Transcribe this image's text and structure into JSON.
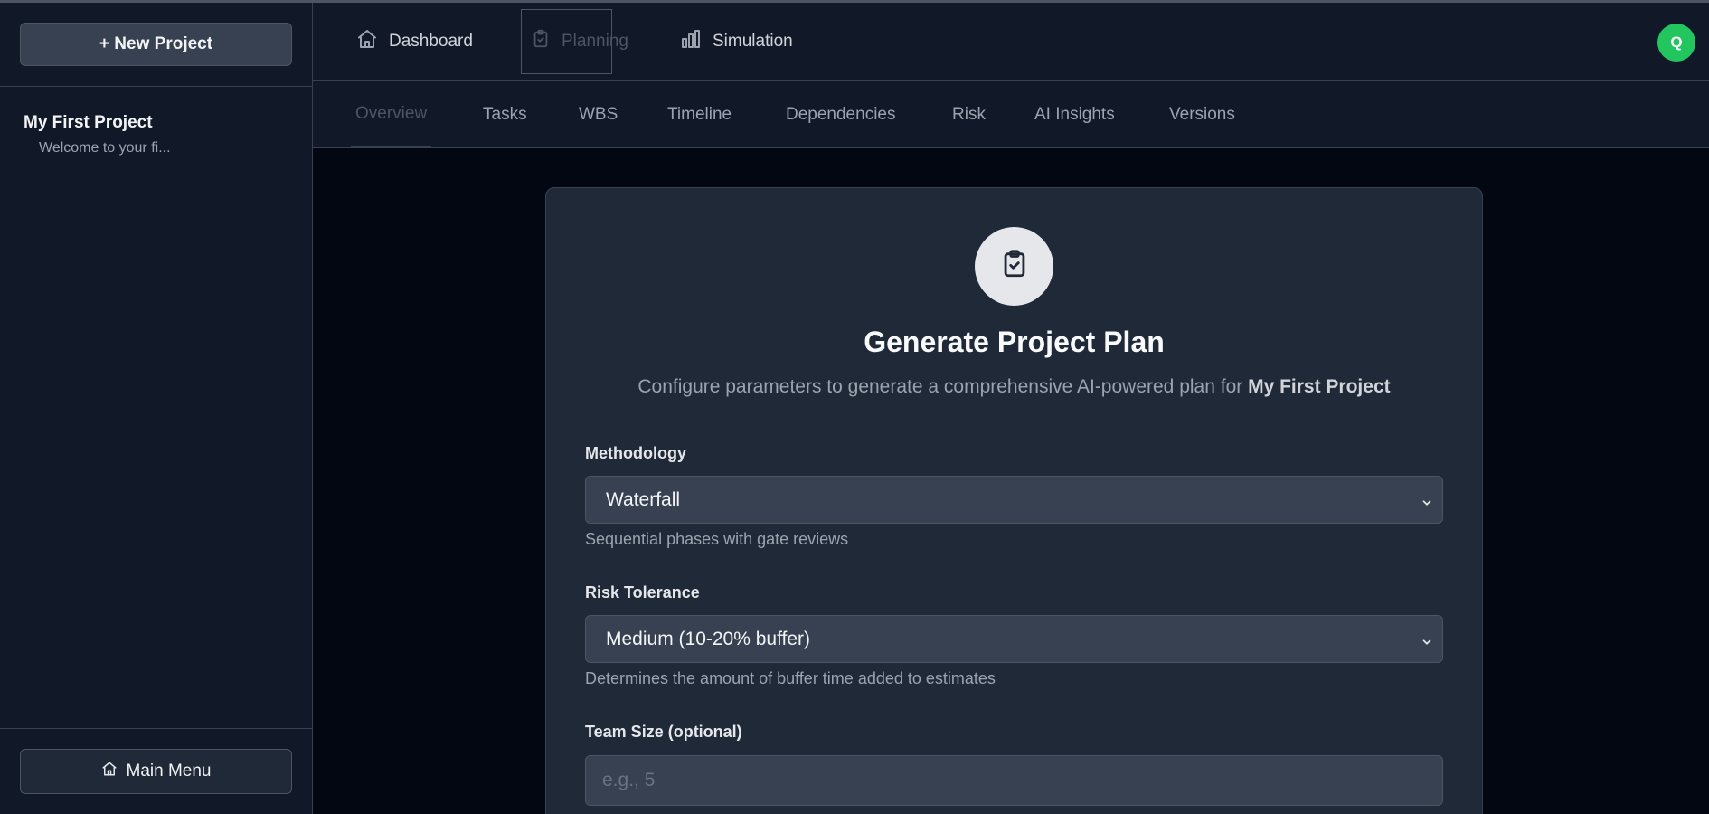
{
  "sidebar": {
    "new_project_label": "+ New Project",
    "project": {
      "name": "My First Project",
      "description": "Welcome to your fi..."
    },
    "main_menu_label": "Main Menu"
  },
  "nav": {
    "dashboard": "Dashboard",
    "planning": "Planning",
    "simulation": "Simulation",
    "avatar_initial": "Q"
  },
  "tabs": {
    "overview": "Overview",
    "tasks": "Tasks",
    "wbs": "WBS",
    "timeline": "Timeline",
    "dependencies": "Dependencies",
    "risk": "Risk",
    "ai_insights": "AI Insights",
    "versions": "Versions"
  },
  "card": {
    "title": "Generate Project Plan",
    "subtitle_prefix": "Configure parameters to generate a comprehensive AI-powered plan for ",
    "subtitle_project": "My First Project",
    "methodology": {
      "label": "Methodology",
      "value": "Waterfall",
      "help": "Sequential phases with gate reviews"
    },
    "risk_tolerance": {
      "label": "Risk Tolerance",
      "value": "Medium (10-20% buffer)",
      "help": "Determines the amount of buffer time added to estimates"
    },
    "team_size": {
      "label": "Team Size (optional)",
      "placeholder": "e.g., 5"
    }
  },
  "colors": {
    "background": "#030712",
    "panel": "#111827",
    "card": "#1f2937",
    "input": "#374151",
    "avatar": "#22c55e"
  }
}
